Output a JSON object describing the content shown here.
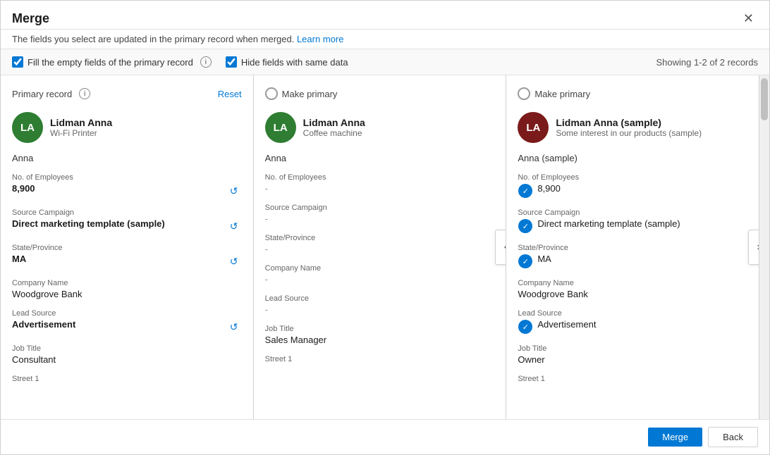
{
  "dialog": {
    "title": "Merge",
    "subtitle": "The fields you select are updated in the primary record when merged.",
    "subtitle_link": "Learn more",
    "close_label": "×",
    "showing_text": "Showing 1-2 of 2 records"
  },
  "options": {
    "fill_empty_label": "Fill the empty fields of the primary record",
    "hide_same_label": "Hide fields with same data"
  },
  "columns": {
    "col1": {
      "header": "Primary record",
      "reset_label": "Reset",
      "avatar_initials": "LA",
      "avatar_color": "green",
      "record_name": "Lidman Anna",
      "record_subtitle": "Wi-Fi Printer",
      "first_name": "Anna",
      "fields": [
        {
          "label": "No. of Employees",
          "value": "8,900",
          "bold": true,
          "has_refresh": true
        },
        {
          "label": "Source Campaign",
          "value": "Direct marketing template (sample)",
          "bold": true,
          "has_refresh": true
        },
        {
          "label": "State/Province",
          "value": "MA",
          "bold": true,
          "has_refresh": true
        },
        {
          "label": "Company Name",
          "value": "Woodgrove Bank",
          "bold": false,
          "has_refresh": false
        },
        {
          "label": "Lead Source",
          "value": "Advertisement",
          "bold": true,
          "has_refresh": true
        },
        {
          "label": "Job Title",
          "value": "Consultant",
          "bold": false,
          "has_refresh": false
        },
        {
          "label": "Street 1",
          "value": "",
          "bold": false,
          "has_refresh": false
        }
      ]
    },
    "col2": {
      "header": "Make primary",
      "avatar_initials": "LA",
      "avatar_color": "green",
      "record_name": "Lidman Anna",
      "record_subtitle": "Coffee machine",
      "first_name": "Anna",
      "fields": [
        {
          "label": "No. of Employees",
          "value": "-",
          "dash": true
        },
        {
          "label": "Source Campaign",
          "value": "-",
          "dash": true
        },
        {
          "label": "State/Province",
          "value": "-",
          "dash": true
        },
        {
          "label": "Company Name",
          "value": "-",
          "dash": true
        },
        {
          "label": "Lead Source",
          "value": "-",
          "dash": true
        },
        {
          "label": "Job Title",
          "value": "Sales Manager",
          "dash": false
        },
        {
          "label": "Street 1",
          "value": "",
          "dash": false
        }
      ]
    },
    "col3": {
      "header": "Make primary",
      "avatar_initials": "LA",
      "avatar_color": "dark-red",
      "record_name": "Lidman Anna (sample)",
      "record_subtitle": "Some interest in our products (sample)",
      "first_name": "Anna (sample)",
      "fields": [
        {
          "label": "No. of Employees",
          "value": "8,900",
          "checked": true,
          "dash": false
        },
        {
          "label": "Source Campaign",
          "value": "Direct marketing template (sample)",
          "checked": true,
          "dash": false
        },
        {
          "label": "State/Province",
          "value": "MA",
          "checked": true,
          "dash": false
        },
        {
          "label": "Company Name",
          "value": "Woodgrove Bank",
          "checked": false,
          "dash": false
        },
        {
          "label": "Lead Source",
          "value": "Advertisement",
          "checked": true,
          "dash": false
        },
        {
          "label": "Job Title",
          "value": "Owner",
          "checked": false,
          "dash": false
        },
        {
          "label": "Street 1",
          "value": "",
          "checked": false,
          "dash": false
        }
      ]
    }
  },
  "footer": {
    "merge_label": "Merge",
    "back_label": "Back"
  },
  "icons": {
    "close": "✕",
    "refresh": "↺",
    "checkmark": "✓",
    "arrow_left": "‹",
    "arrow_right": "›",
    "info": "i"
  }
}
